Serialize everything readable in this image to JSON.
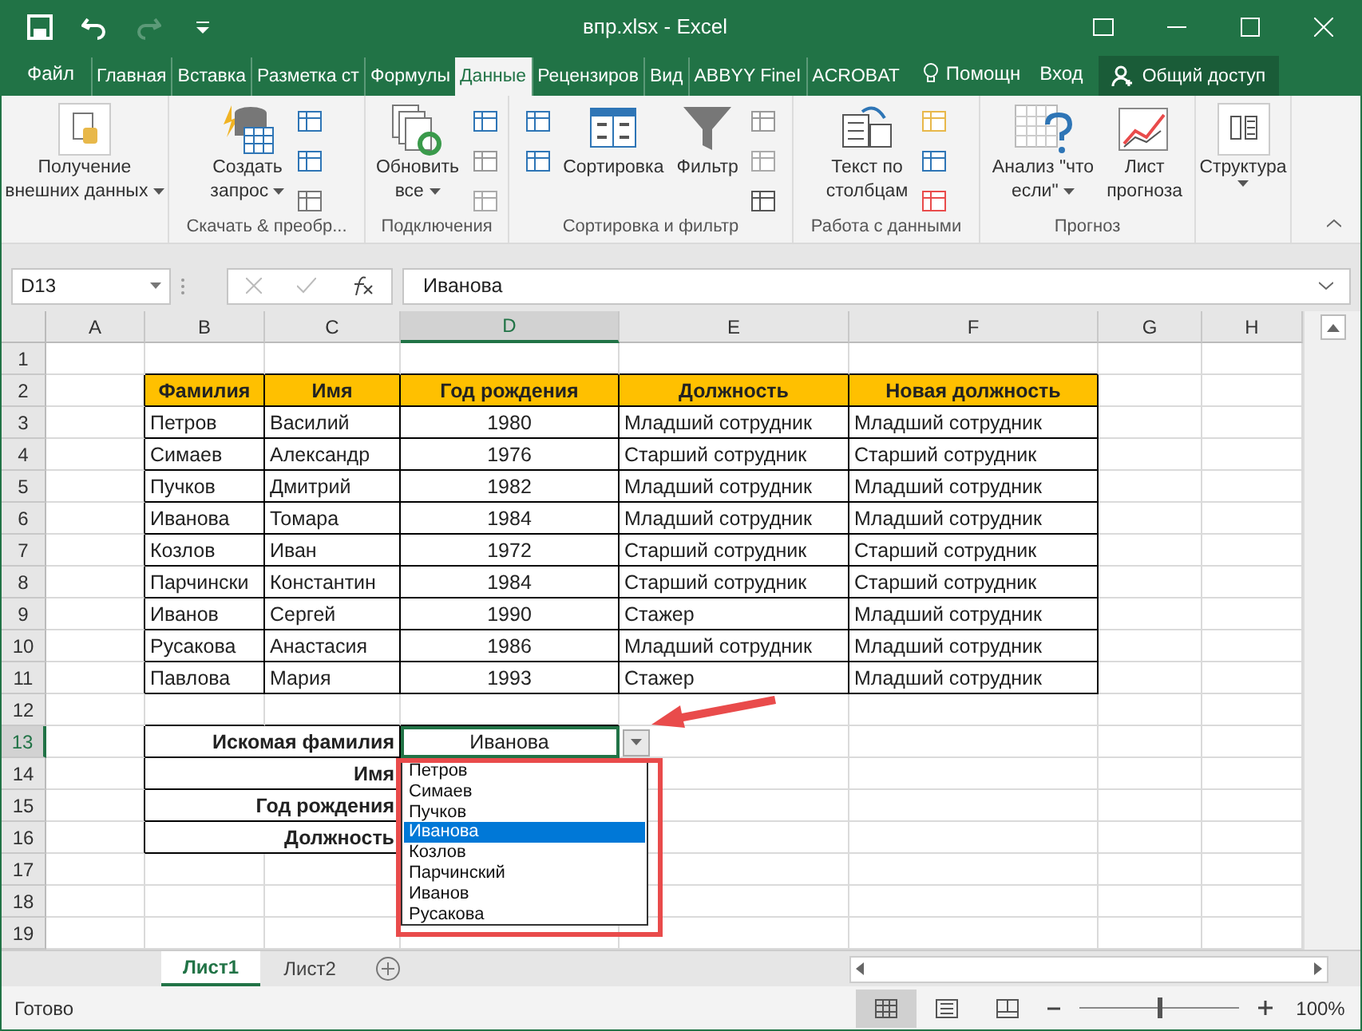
{
  "window": {
    "title": "впр.xlsx - Excel"
  },
  "menu": {
    "file": "Файл",
    "tabs": [
      {
        "label": "Главная",
        "selected": false
      },
      {
        "label": "Вставка",
        "selected": false
      },
      {
        "label": "Разметка ст",
        "selected": false
      },
      {
        "label": "Формулы",
        "selected": false
      },
      {
        "label": "Данные",
        "selected": true
      },
      {
        "label": "Рецензиров",
        "selected": false
      },
      {
        "label": "Вид",
        "selected": false
      },
      {
        "label": "ABBYY FineI",
        "selected": false
      },
      {
        "label": "ACROBAT",
        "selected": false
      }
    ],
    "help": "Помощн",
    "signin": "Вход",
    "share": "Общий доступ"
  },
  "ribbon": [
    {
      "buttons": [
        {
          "lines": [
            "Получение",
            "внешних данных"
          ],
          "dropdown": true
        }
      ]
    },
    {
      "label": "Скачать & преобр...",
      "buttons": [
        {
          "lines": [
            "Создать",
            "запрос"
          ],
          "dropdown": true
        }
      ]
    },
    {
      "label": "Подключения",
      "buttons": [
        {
          "lines": [
            "Обновить",
            "все"
          ],
          "dropdown": true
        }
      ]
    },
    {
      "label": "Сортировка и фильтр",
      "buttons": [
        {
          "lines": [
            "Сортировка"
          ],
          "dropdown": false
        },
        {
          "lines": [
            "Фильтр"
          ],
          "dropdown": false
        }
      ]
    },
    {
      "label": "Работа с данными",
      "buttons": [
        {
          "lines": [
            "Текст по",
            "столбцам"
          ],
          "dropdown": false
        }
      ]
    },
    {
      "label": "Прогноз",
      "buttons": [
        {
          "lines": [
            "Анализ \"что",
            "если\""
          ],
          "dropdown": true
        },
        {
          "lines": [
            "Лист",
            "прогноза"
          ],
          "dropdown": false
        }
      ]
    },
    {
      "buttons": [
        {
          "lines": [
            "Структура"
          ],
          "dropdown": true
        }
      ]
    }
  ],
  "name_box": "D13",
  "formula": "Иванова",
  "columns": [
    {
      "label": "A",
      "selected": false
    },
    {
      "label": "B",
      "selected": false
    },
    {
      "label": "C",
      "selected": false
    },
    {
      "label": "D",
      "selected": true
    },
    {
      "label": "E",
      "selected": false
    },
    {
      "label": "F",
      "selected": false
    },
    {
      "label": "G",
      "selected": false
    },
    {
      "label": "H",
      "selected": false
    }
  ],
  "rows": [
    {
      "number": "1",
      "selected": false,
      "kind": "empty"
    },
    {
      "number": "2",
      "selected": false,
      "kind": "header",
      "cells": [
        "Фамилия",
        "Имя",
        "Год рождения",
        "Должность",
        "Новая должность"
      ]
    },
    {
      "number": "3",
      "selected": false,
      "kind": "data",
      "cells": [
        "Петров",
        "Василий",
        "1980",
        "Младший сотрудник",
        "Младший сотрудник"
      ]
    },
    {
      "number": "4",
      "selected": false,
      "kind": "data",
      "cells": [
        "Симаев",
        "Александр",
        "1976",
        "Старший сотрудник",
        "Старший сотрудник"
      ]
    },
    {
      "number": "5",
      "selected": false,
      "kind": "data",
      "cells": [
        "Пучков",
        "Дмитрий",
        "1982",
        "Младший сотрудник",
        "Младший сотрудник"
      ]
    },
    {
      "number": "6",
      "selected": false,
      "kind": "data",
      "cells": [
        "Иванова",
        "Томара",
        "1984",
        "Младший сотрудник",
        "Младший сотрудник"
      ]
    },
    {
      "number": "7",
      "selected": false,
      "kind": "data",
      "cells": [
        "Козлов",
        "Иван",
        "1972",
        "Старший сотрудник",
        "Старший сотрудник"
      ]
    },
    {
      "number": "8",
      "selected": false,
      "kind": "data",
      "cells": [
        "Парчински",
        "Константин",
        "1984",
        "Старший сотрудник",
        "Старший сотрудник"
      ]
    },
    {
      "number": "9",
      "selected": false,
      "kind": "data",
      "cells": [
        "Иванов",
        "Сергей",
        "1990",
        "Стажер",
        "Младший сотрудник"
      ]
    },
    {
      "number": "10",
      "selected": false,
      "kind": "data",
      "cells": [
        "Русакова",
        "Анастасия",
        "1986",
        "Младший сотрудник",
        "Младший сотрудник"
      ]
    },
    {
      "number": "11",
      "selected": false,
      "kind": "data",
      "cells": [
        "Павлова",
        "Мария",
        "1993",
        "Стажер",
        "Младший сотрудник"
      ]
    },
    {
      "number": "12",
      "selected": false,
      "kind": "empty"
    },
    {
      "number": "13",
      "selected": true,
      "kind": "lookup",
      "cells": [
        "Искомая фамилия",
        "Иванова"
      ]
    },
    {
      "number": "14",
      "selected": false,
      "kind": "lookup",
      "cells": [
        "Имя"
      ]
    },
    {
      "number": "15",
      "selected": false,
      "kind": "lookup",
      "cells": [
        "Год рождения"
      ]
    },
    {
      "number": "16",
      "selected": false,
      "kind": "lookup",
      "cells": [
        "Должность"
      ]
    },
    {
      "number": "17",
      "selected": false,
      "kind": "empty"
    },
    {
      "number": "18",
      "selected": false,
      "kind": "empty"
    },
    {
      "number": "19",
      "selected": false,
      "kind": "empty"
    }
  ],
  "dropdown": {
    "options": [
      {
        "label": "Петров",
        "selected": false
      },
      {
        "label": "Симаев",
        "selected": false
      },
      {
        "label": "Пучков",
        "selected": false
      },
      {
        "label": "Иванова",
        "selected": true
      },
      {
        "label": "Козлов",
        "selected": false
      },
      {
        "label": "Парчинский",
        "selected": false
      },
      {
        "label": "Иванов",
        "selected": false
      },
      {
        "label": "Русакова",
        "selected": false
      }
    ]
  },
  "sheets": [
    {
      "label": "Лист1",
      "selected": true
    },
    {
      "label": "Лист2",
      "selected": false
    }
  ],
  "status": {
    "text": "Готово",
    "views": [
      {
        "selected": true
      },
      {
        "selected": false
      },
      {
        "selected": false
      }
    ],
    "zoom": {
      "level": 0.5,
      "reading": "100%"
    }
  }
}
